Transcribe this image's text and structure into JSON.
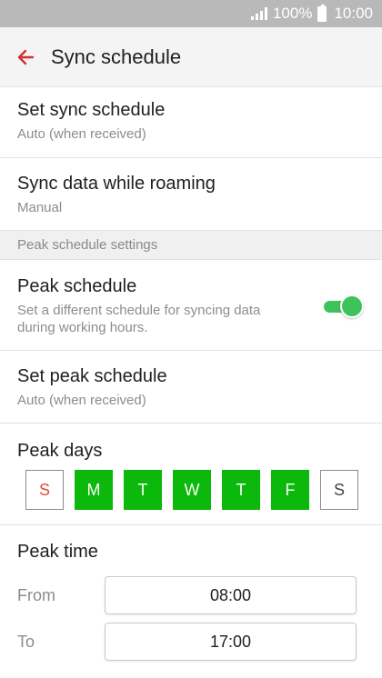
{
  "status_bar": {
    "battery": "100%",
    "time": "10:00",
    "signal_icon": "signal-icon",
    "battery_icon": "battery-icon"
  },
  "app_bar": {
    "title": "Sync schedule",
    "back_icon": "back-arrow-icon"
  },
  "settings": {
    "sync_schedule": {
      "title": "Set sync schedule",
      "value": "Auto (when received)"
    },
    "roaming": {
      "title": "Sync data while roaming",
      "value": "Manual"
    },
    "section_header": "Peak schedule settings",
    "peak_schedule": {
      "title": "Peak schedule",
      "description": "Set a different schedule for syncing data during working hours.",
      "enabled": true
    },
    "set_peak_schedule": {
      "title": "Set peak schedule",
      "value": "Auto (when received)"
    },
    "peak_days": {
      "title": "Peak days",
      "days": [
        {
          "label": "S",
          "selected": false
        },
        {
          "label": "M",
          "selected": true
        },
        {
          "label": "T",
          "selected": true
        },
        {
          "label": "W",
          "selected": true
        },
        {
          "label": "T",
          "selected": true
        },
        {
          "label": "F",
          "selected": true
        },
        {
          "label": "S",
          "selected": false
        }
      ]
    },
    "peak_time": {
      "title": "Peak time",
      "from_label": "From",
      "from_value": "08:00",
      "to_label": "To",
      "to_value": "17:00"
    }
  },
  "colors": {
    "accent_red": "#d32f2f",
    "toggle_green": "#3ec35a",
    "day_green": "#0bb80b",
    "sunday_red": "#e24b3e"
  }
}
